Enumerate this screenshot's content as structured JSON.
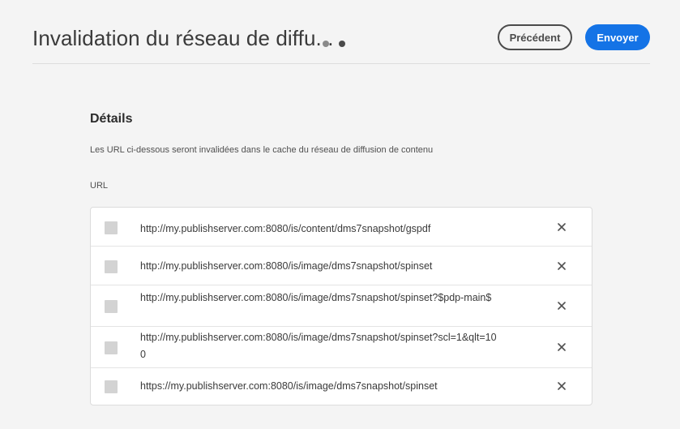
{
  "header": {
    "title": "Invalidation du réseau de diffu...",
    "buttons": {
      "previous": "Précédent",
      "submit": "Envoyer"
    },
    "accent_color": "#1473e6"
  },
  "details": {
    "heading": "Détails",
    "description": "Les URL ci-dessous seront invalidées dans le cache du réseau de diffusion de contenu",
    "field_label": "URL",
    "urls": [
      "http://my.publishserver.com:8080/is/content/dms7snapshot/gspdf",
      "http://my.publishserver.com:8080/is/image/dms7snapshot/spinset",
      "http://my.publishserver.com:8080/is/image/dms7snapshot/spinset?$pdp-main$",
      "http://my.publishserver.com:8080/is/image/dms7snapshot/spinset?scl=1&qlt=100",
      "https://my.publishserver.com:8080/is/image/dms7snapshot/spinset"
    ],
    "row_icons": {
      "checkbox": "checkbox-icon",
      "remove": "close-icon"
    }
  }
}
